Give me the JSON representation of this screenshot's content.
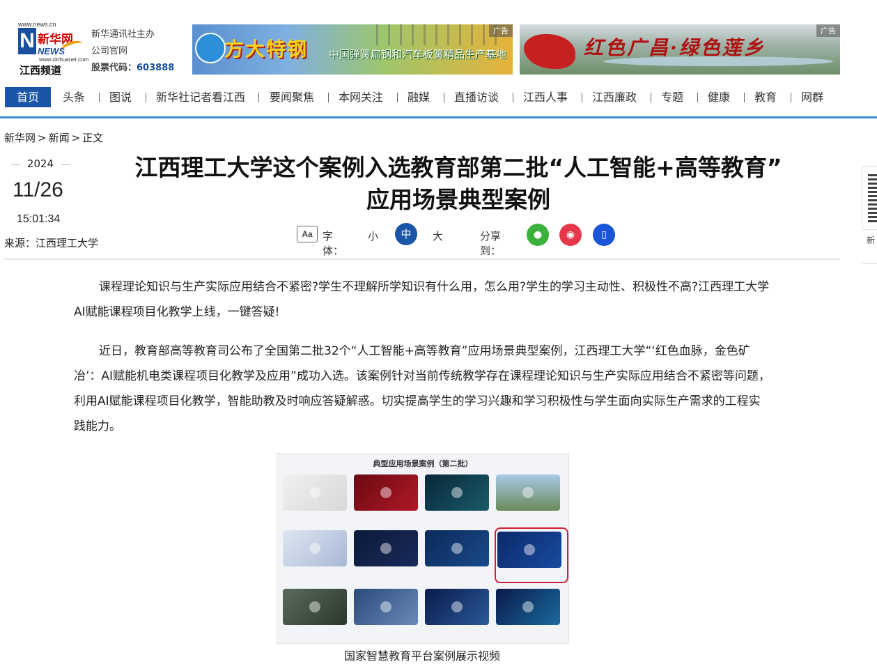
{
  "header": {
    "logo": {
      "url": "www.news.cn",
      "brand_cn": "新华网",
      "brand_en": "NEWS",
      "sub": "www.xinhuanet.com",
      "channel": "江西频道"
    },
    "org_info": {
      "line1": "新华通讯社主办",
      "line2": "公司官网",
      "stock_label": "股票代码：",
      "stock_code": "603888"
    },
    "ads": [
      {
        "tag": "广告",
        "title": "方大特钢",
        "subtitle": "中国弹簧扁钢和汽车板簧精品生产基地"
      },
      {
        "tag": "广告",
        "title": "红色广昌·绿色莲乡"
      }
    ]
  },
  "nav": {
    "items": [
      "首页",
      "头条",
      "图说",
      "新华社记者看江西",
      "要闻聚焦",
      "本网关注",
      "融媒",
      "直播访谈",
      "江西人事",
      "江西廉政",
      "专题",
      "健康",
      "教育",
      "网群"
    ],
    "active": "首页"
  },
  "breadcrumb": [
    "新华网",
    ">",
    "新闻",
    ">",
    "正文"
  ],
  "article": {
    "date_year": "2024",
    "date_md": "11/26",
    "time": "15:01:34",
    "source": "来源：江西理工大学",
    "title_line1": "江西理工大学这个案例入选教育部第二批“人工智能+高等教育”",
    "title_line2": "应用场景典型案例",
    "font_label": "字体：",
    "font_small": "小",
    "font_medium": "中",
    "font_large": "大",
    "share_label": "分享到：",
    "paragraph1": "课程理论知识与生产实际应用结合不紧密?学生不理解所学知识有什么用，怎么用?学生的学习主动性、积极性不高?江西理工大学AI赋能课程项目化教学上线，一键答疑!",
    "paragraph2": "近日，教育部高等教育司公布了全国第二批32个“人工智能+高等教育”应用场景典型案例，江西理工大学“‘红色血脉，金色矿冶’：AI赋能机电类课程项目化教学及应用”成功入选。该案例针对当前传统教学存在课程理论知识与生产实际应用结合不紧密等问题，利用AI赋能课程项目化教学，智能助教及时响应答疑解惑。切实提高学生的学习兴趣和学习积极性与学生面向实际生产需求的工程实践能力。",
    "figure_title": "典型应用场景案例（第二批）",
    "figure_caption": "国家智慧教育平台案例展示视频"
  },
  "side": {
    "text": "新"
  },
  "colors": {
    "nav_active": "#1a55a8",
    "nav_line": "#3d8bd6",
    "wechat": "#3ab13a",
    "weibo": "#e6384a",
    "mobile": "#1a55d8"
  }
}
